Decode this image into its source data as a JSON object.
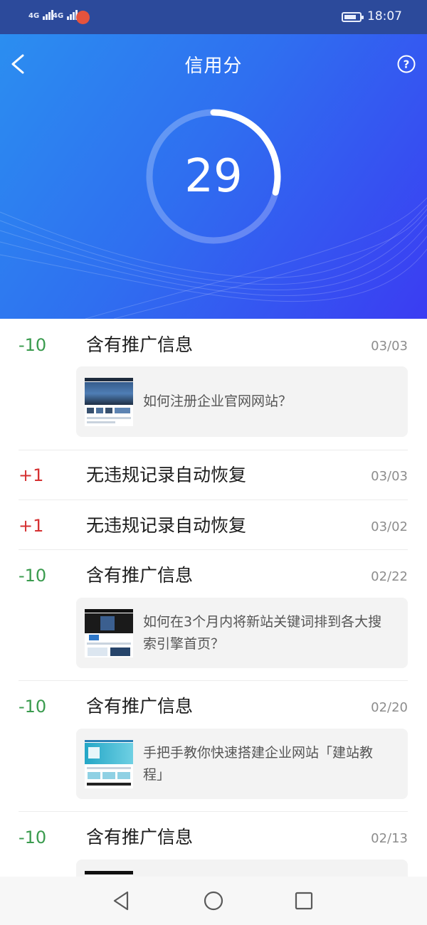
{
  "status_bar": {
    "network_1": "4G",
    "network_2": "4G",
    "time": "18:07",
    "icons": [
      "signal-4g-icon",
      "signal-4g-icon",
      "notification-app-icon",
      "battery-icon"
    ]
  },
  "header": {
    "title": "信用分",
    "back_icon": "chevron-left-icon",
    "help_icon": "help-circle-icon",
    "score": "29",
    "score_fraction": 0.29,
    "colors": {
      "gradient_start": "#2b8ef0",
      "gradient_end": "#3b3cf2"
    }
  },
  "records": [
    {
      "delta": "-10",
      "type": "negative",
      "reason": "含有推广信息",
      "date": "03/03",
      "article": "如何注册企业官网网站？"
    },
    {
      "delta": "+1",
      "type": "positive",
      "reason": "无违规记录自动恢复",
      "date": "03/03"
    },
    {
      "delta": "+1",
      "type": "positive",
      "reason": "无违规记录自动恢复",
      "date": "03/02"
    },
    {
      "delta": "-10",
      "type": "negative",
      "reason": "含有推广信息",
      "date": "02/22",
      "article": "如何在3个月内将新站关键词排到各大搜索引擎首页？"
    },
    {
      "delta": "-10",
      "type": "negative",
      "reason": "含有推广信息",
      "date": "02/20",
      "article": "手把手教你快速搭建企业网站「建站教程」"
    },
    {
      "delta": "-10",
      "type": "negative",
      "reason": "含有推广信息",
      "date": "02/13"
    }
  ],
  "colors": {
    "negative": "#3a9b4e",
    "positive": "#d53031"
  },
  "navbar": {
    "icons": [
      "back-triangle-icon",
      "home-circle-icon",
      "recents-square-icon"
    ]
  }
}
